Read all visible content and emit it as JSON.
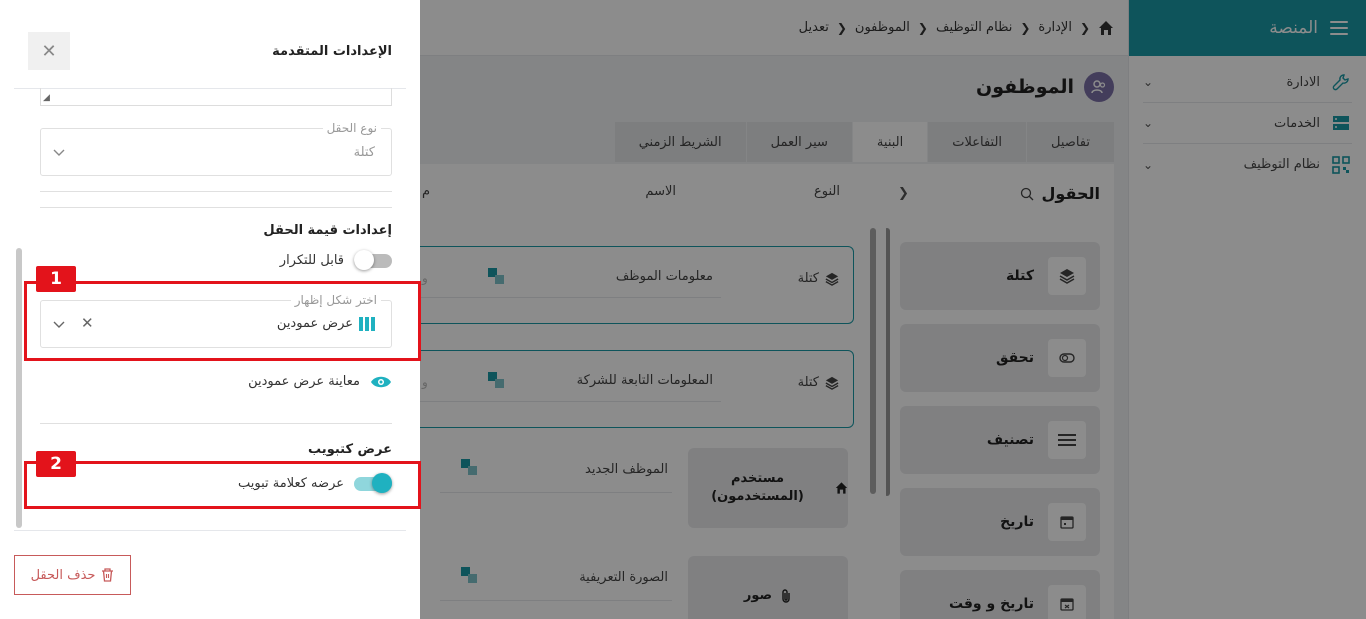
{
  "sidebar": {
    "title": "المنصة",
    "items": [
      {
        "label": "الادارة",
        "icon": "wrench-icon"
      },
      {
        "label": "الخدمات",
        "icon": "server-icon"
      },
      {
        "label": "نظام التوظيف",
        "icon": "qr-grid-icon"
      }
    ]
  },
  "breadcrumb": [
    "الإدارة",
    "نظام التوظيف",
    "الموظفون",
    "تعديل"
  ],
  "page": {
    "title": "الموظفون"
  },
  "tabs": [
    {
      "label": "تفاصيل",
      "active": false
    },
    {
      "label": "التفاعلات",
      "active": false
    },
    {
      "label": "البنية",
      "active": true
    },
    {
      "label": "سير العمل",
      "active": false
    },
    {
      "label": "الشريط الزمني",
      "active": false
    }
  ],
  "fields_panel": {
    "title": "الحقول",
    "tiles": [
      {
        "label": "كتلة",
        "icon": "layers-icon"
      },
      {
        "label": "تحقق",
        "icon": "toggle-icon"
      },
      {
        "label": "تصنيف",
        "icon": "list-icon"
      },
      {
        "label": "تاريخ",
        "icon": "calendar-icon"
      },
      {
        "label": "تاريخ و وقت",
        "icon": "calendar-time-icon"
      }
    ]
  },
  "grid": {
    "columns": {
      "type": "النوع",
      "name": "الاسم",
      "more": "م"
    },
    "cards": [
      {
        "type": "كتلة",
        "name": "معلومات الموظف",
        "frag": "و"
      },
      {
        "type": "كتلة",
        "name": "المعلومات التابعة للشركة",
        "frag": "و"
      }
    ],
    "plain_cards": [
      {
        "type_label": "مستخدم (المستخدمون)",
        "name": "الموظف الجديد",
        "icon": "home-icon"
      },
      {
        "type_label": "صور",
        "name": "الصورة التعريفية",
        "icon": "paperclip-icon"
      }
    ]
  },
  "drawer": {
    "title": "الإعدادات المتقدمة",
    "field_type": {
      "legend": "نوع الحقل",
      "value": "كتلة"
    },
    "value_settings_title": "إعدادات قيمة الحقل",
    "repeatable": {
      "label": "قابل للتكرار",
      "on": false
    },
    "display": {
      "legend": "اختر شكل إظهار",
      "value": "عرض عمودين"
    },
    "preview_label": "معاينة عرض عمودين",
    "tab_section_title": "عرض كتبويب",
    "show_as_tab": {
      "label": "عرضه كعلامة تبويب",
      "on": true
    },
    "delete_label": "حذف الحقل"
  },
  "annotations": {
    "badge1": "1",
    "badge2": "2"
  },
  "colors": {
    "accent": "#1a9aa6",
    "highlight": "#e3131b",
    "switch_on": "#1fb1c0"
  }
}
